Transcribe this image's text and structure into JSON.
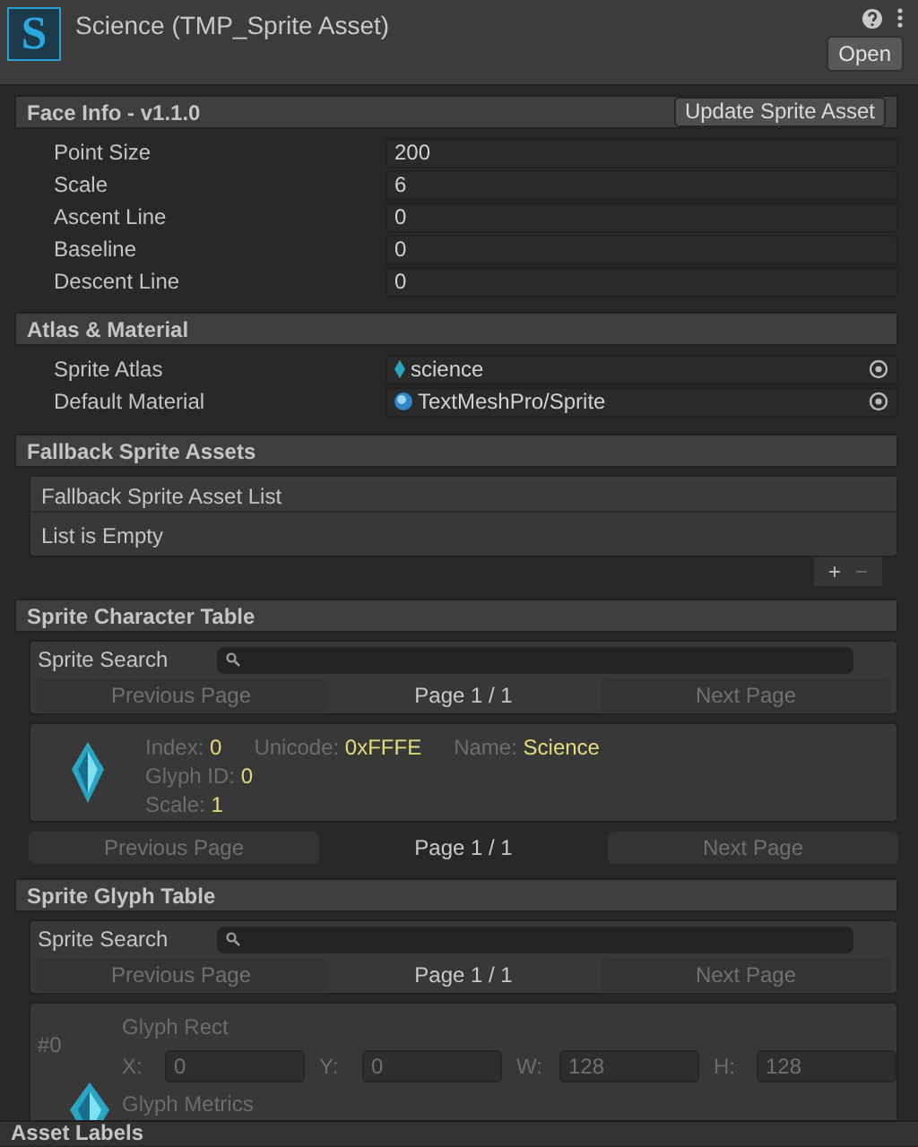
{
  "header": {
    "logo": "S",
    "title": "Science (TMP_Sprite Asset)",
    "open_button": "Open"
  },
  "face_info": {
    "title": "Face Info - v1.1.0",
    "button": "Update Sprite Asset",
    "fields": [
      {
        "label": "Point Size",
        "value": "200"
      },
      {
        "label": "Scale",
        "value": "6"
      },
      {
        "label": "Ascent Line",
        "value": "0"
      },
      {
        "label": "Baseline",
        "value": "0"
      },
      {
        "label": "Descent Line",
        "value": "0"
      }
    ]
  },
  "atlas_material": {
    "title": "Atlas & Material",
    "fields": [
      {
        "label": "Sprite Atlas",
        "value": "science",
        "kind": "sprite"
      },
      {
        "label": "Default Material",
        "value": "TextMeshPro/Sprite",
        "kind": "material"
      }
    ]
  },
  "fallback": {
    "title": "Fallback Sprite Assets",
    "list_header": "Fallback Sprite Asset List",
    "empty_text": "List is Empty",
    "add": "+",
    "remove": "−"
  },
  "character_table": {
    "title": "Sprite Character Table",
    "search_label": "Sprite Search",
    "pager": {
      "previous": "Previous Page",
      "page": "Page 1 / 1",
      "next": "Next Page",
      "disabled": true
    },
    "character": {
      "rows": [
        [
          {
            "label": "Index:",
            "value": "0"
          },
          {
            "label": "Unicode:",
            "value": "0xFFFE"
          },
          {
            "label": "Name:",
            "value": "Science"
          }
        ],
        [
          {
            "label": "Glyph ID:",
            "value": "0"
          }
        ],
        [
          {
            "label": "Scale:",
            "value": "1"
          }
        ]
      ]
    },
    "bottom_pager": {
      "previous": "Previous Page",
      "page": "Page 1 / 1",
      "next": "Next Page",
      "disabled": true
    }
  },
  "glyph_table": {
    "title": "Sprite Glyph Table",
    "search_label": "Sprite Search",
    "pager": {
      "previous": "Previous Page",
      "page": "Page 1 / 1",
      "next": "Next Page",
      "disabled": true
    },
    "glyph": {
      "index": "#0",
      "rect_label": "Glyph Rect",
      "rect": [
        {
          "label": "X:",
          "value": "0"
        },
        {
          "label": "Y:",
          "value": "0"
        },
        {
          "label": "W:",
          "value": "128"
        },
        {
          "label": "H:",
          "value": "128"
        }
      ],
      "metrics_label": "Glyph Metrics"
    }
  },
  "footer": {
    "title": "Asset Labels"
  }
}
